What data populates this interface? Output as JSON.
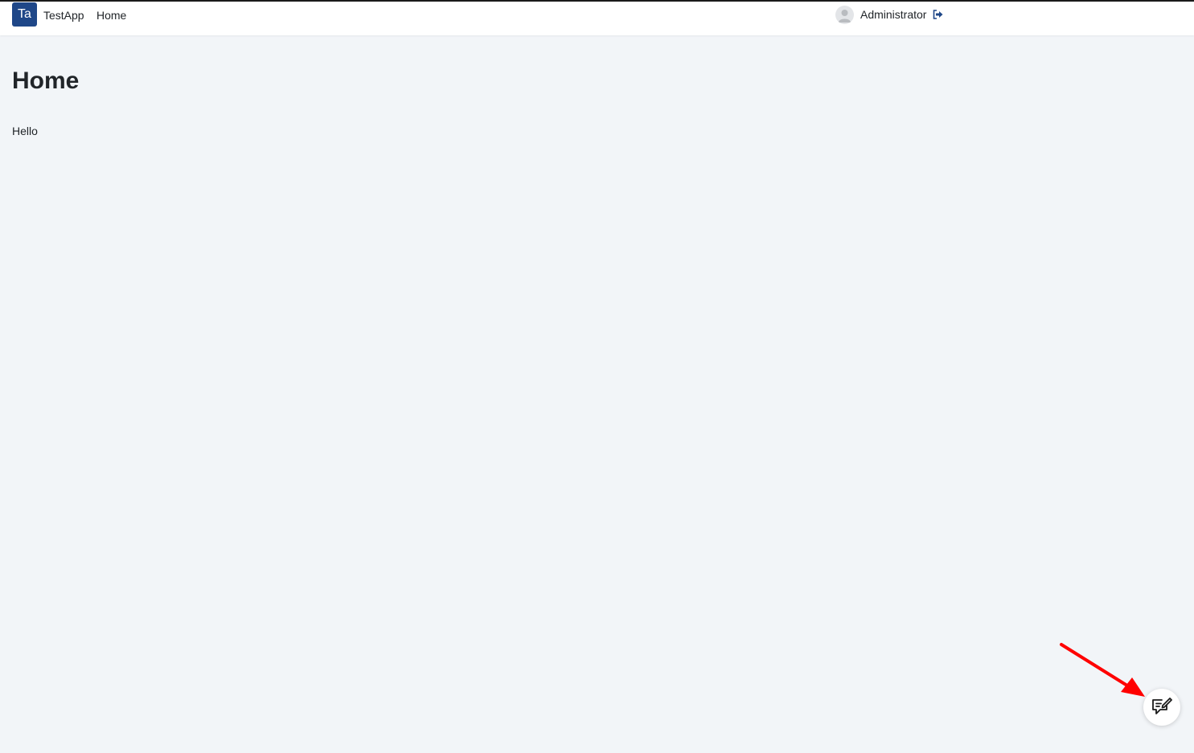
{
  "header": {
    "logo_text": "Ta",
    "app_name": "TestApp",
    "nav": [
      {
        "label": "Home"
      }
    ],
    "user": {
      "name": "Administrator",
      "avatar_icon": "user-silhouette-icon",
      "logout_icon": "sign-out-icon"
    }
  },
  "main": {
    "title": "Home",
    "text": "Hello"
  },
  "feedback_button": {
    "icon": "chat-edit-icon"
  },
  "colors": {
    "brand": "#1f4788",
    "background": "#f2f5f8",
    "annotation_arrow": "#ff0000"
  }
}
